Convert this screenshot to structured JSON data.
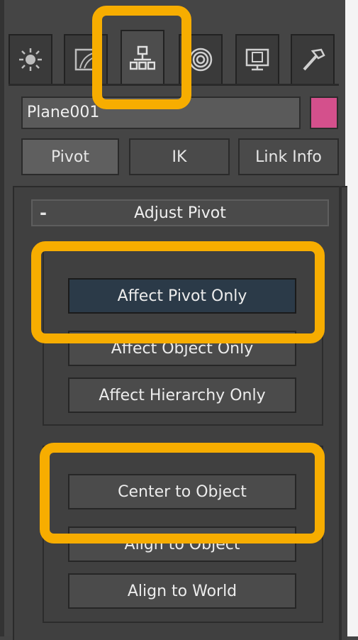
{
  "name_field": {
    "value": "Plane001"
  },
  "color_swatch": "#d4508c",
  "tabs": [
    {
      "name": "create",
      "icon": "sun-icon"
    },
    {
      "name": "modify",
      "icon": "bend-icon"
    },
    {
      "name": "hierarchy",
      "icon": "hierarchy-icon",
      "active": true
    },
    {
      "name": "motion",
      "icon": "motion-icon"
    },
    {
      "name": "display",
      "icon": "display-icon"
    },
    {
      "name": "utilities",
      "icon": "hammer-icon"
    }
  ],
  "subtabs": {
    "pivot": "Pivot",
    "ik": "IK",
    "link_info": "Link Info"
  },
  "rollout": {
    "minus": "-",
    "title": "Adjust Pivot"
  },
  "move_rotate": {
    "affect_pivot": "Affect Pivot Only",
    "affect_object": "Affect Object Only",
    "affect_hierarchy": "Affect Hierarchy Only"
  },
  "alignment": {
    "center_to_object": "Center to Object",
    "align_to_object": "Align to Object",
    "align_to_world": "Align to World"
  },
  "highlight_color": "#f7ad00"
}
